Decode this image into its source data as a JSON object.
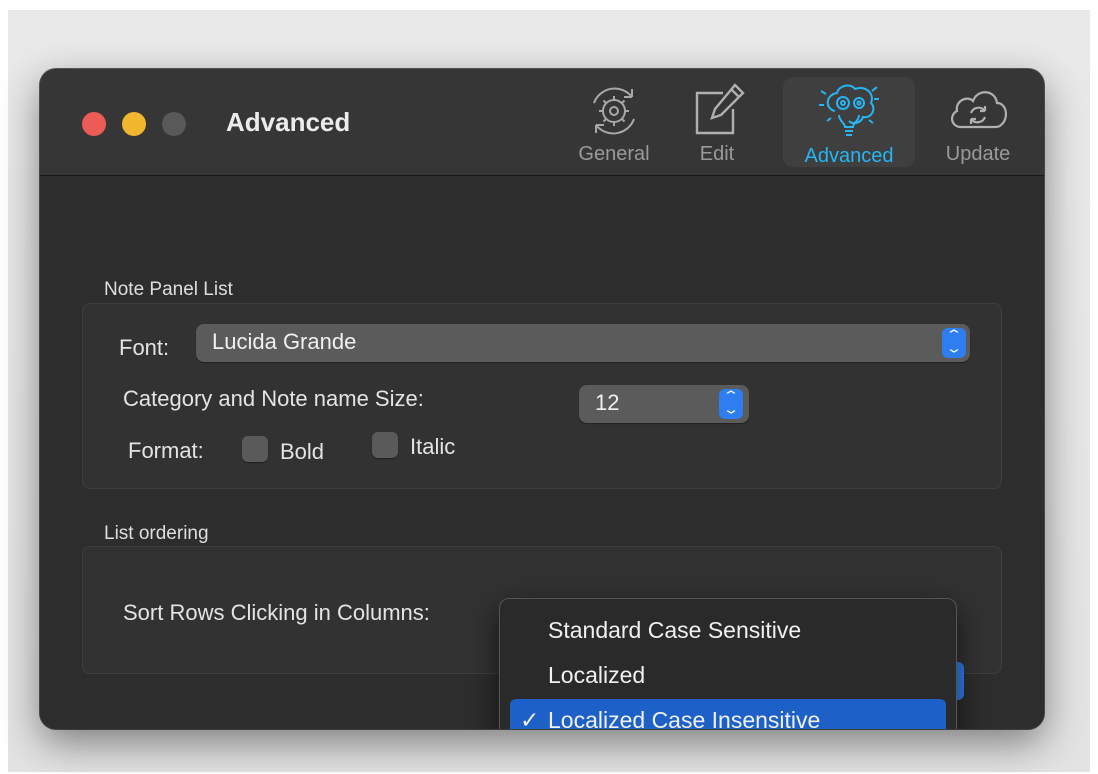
{
  "window": {
    "title": "Advanced"
  },
  "toolbar": {
    "items": [
      {
        "label": "General",
        "icon": "gear-cycle-icon"
      },
      {
        "label": "Edit",
        "icon": "pencil-square-icon"
      },
      {
        "label": "Advanced",
        "icon": "brain-gears-bulb-icon"
      },
      {
        "label": "Update",
        "icon": "cloud-refresh-icon"
      }
    ],
    "active": "Advanced"
  },
  "note_panel": {
    "section_title": "Note Panel List",
    "font_label": "Font:",
    "font_value": "Lucida Grande",
    "size_label": "Category and Note name Size:",
    "size_value": "12",
    "format_label": "Format:",
    "bold_label": "Bold",
    "bold_checked": false,
    "italic_label": "Italic",
    "italic_checked": false
  },
  "list_ordering": {
    "section_title": "List ordering",
    "sort_label": "Sort Rows Clicking in Columns:",
    "menu_options": [
      {
        "label": "Standard Case Sensitive",
        "selected": false
      },
      {
        "label": "Localized",
        "selected": false
      },
      {
        "label": "Localized Case Insensitive",
        "selected": true
      }
    ],
    "check_mark": "✓"
  },
  "colors": {
    "accent": "#26b6f3",
    "selection": "#1d61c8",
    "stepper": "#2f7ef1",
    "close": "#ec5b55",
    "minimize": "#f1b72f"
  }
}
